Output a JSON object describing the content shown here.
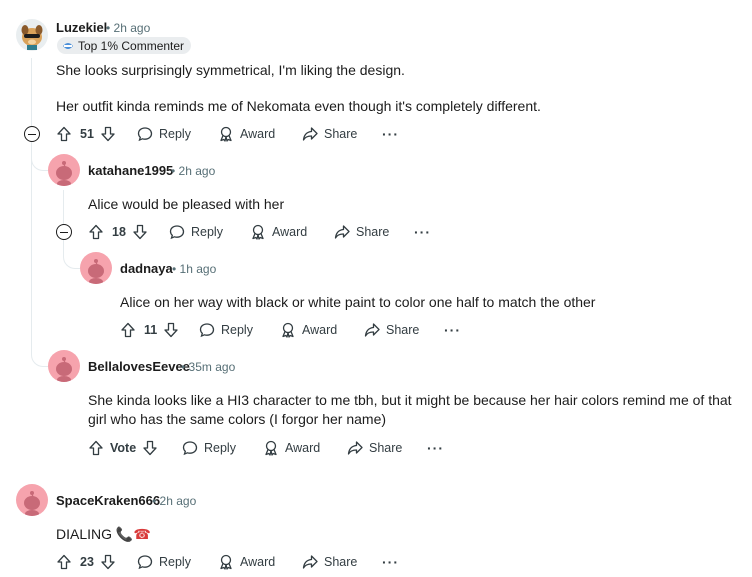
{
  "comments": [
    {
      "username": "Luzekiel",
      "time": "2h ago",
      "badge": "Top 1% Commenter",
      "paragraphs": [
        "She looks surprisingly symmetrical, I'm liking the design.",
        "Her outfit kinda reminds me of Nekomata even though it's completely different."
      ],
      "score": "51"
    },
    {
      "username": "katahane1995",
      "time": "2h ago",
      "text": "Alice would be pleased with her",
      "score": "18"
    },
    {
      "username": "dadnaya",
      "time": "1h ago",
      "text": "Alice on her way with black or white paint to color one half to match the other",
      "score": "11"
    },
    {
      "username": "BellalovesEevee",
      "time": "35m ago",
      "text_line1": "She kinda looks like a HI3 character to me tbh, but it might be because her hair colors remind me of that",
      "text_line2": "girl who has the same colors (I forgor her name)",
      "score": "Vote"
    },
    {
      "username": "SpaceKraken666",
      "time": "2h ago",
      "text": "DIALING",
      "emoji": "📞☎",
      "score": "23"
    }
  ],
  "actions": {
    "reply": "Reply",
    "award": "Award",
    "share": "Share",
    "more": "···"
  },
  "separator": "•",
  "colors": {
    "default_avatar_bg": "#f6a3ad",
    "snoo_body": "#c86a78",
    "badge_bg": "#eaedef",
    "meta_text": "#576f76"
  },
  "icons": [
    "upvote-icon",
    "downvote-icon",
    "reply-icon",
    "award-icon",
    "share-icon",
    "collapse-icon",
    "badge-icon",
    "avatar-snoo-icon"
  ]
}
